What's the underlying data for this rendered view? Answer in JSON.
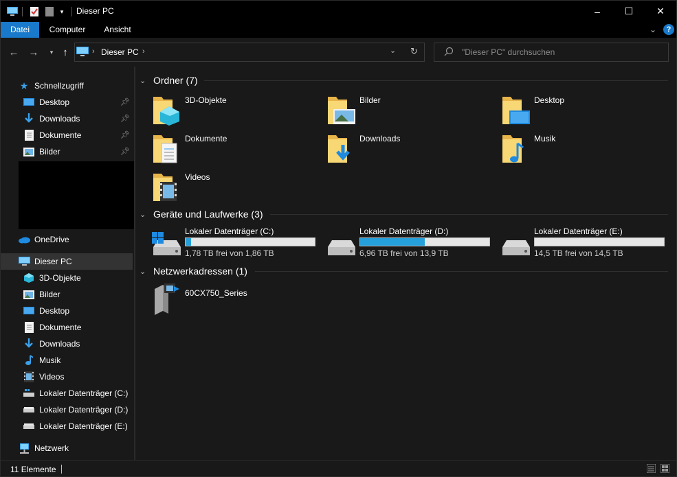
{
  "window": {
    "title": "Dieser PC",
    "controls": {
      "minimize": "–",
      "maximize": "☐",
      "close": "✕"
    }
  },
  "ribbon": {
    "tabs": [
      "Datei",
      "Computer",
      "Ansicht"
    ],
    "active_tab": "Datei",
    "accent_color": "#1979ca"
  },
  "navigation": {
    "breadcrumb": "Dieser PC",
    "search_placeholder": "\"Dieser PC\" durchsuchen"
  },
  "sidebar": {
    "quick_access": {
      "label": "Schnellzugriff",
      "items": [
        "Desktop",
        "Downloads",
        "Dokumente",
        "Bilder"
      ]
    },
    "onedrive": "OneDrive",
    "this_pc": {
      "label": "Dieser PC",
      "items": [
        "3D-Objekte",
        "Bilder",
        "Desktop",
        "Dokumente",
        "Downloads",
        "Musik",
        "Videos",
        "Lokaler Datenträger (C:)",
        "Lokaler Datenträger (D:)",
        "Lokaler Datenträger (E:)"
      ]
    },
    "network": "Netzwerk"
  },
  "content": {
    "folders_header": "Ordner (7)",
    "folders": [
      "3D-Objekte",
      "Bilder",
      "Desktop",
      "Dokumente",
      "Downloads",
      "Musik",
      "Videos"
    ],
    "drives_header": "Geräte und Laufwerke (3)",
    "drives": [
      {
        "name": "Lokaler Datenträger (C:)",
        "free": "1,78 TB frei von 1,86 TB",
        "used_fraction": 0.043
      },
      {
        "name": "Lokaler Datenträger (D:)",
        "free": "6,96 TB frei von 13,9 TB",
        "used_fraction": 0.5
      },
      {
        "name": "Lokaler Datenträger (E:)",
        "free": "14,5 TB frei von 14,5 TB",
        "used_fraction": 0.0
      }
    ],
    "network_header": "Netzwerkadressen (1)",
    "network_locations": [
      "60CX750_Series"
    ]
  },
  "statusbar": {
    "text": "11 Elemente"
  }
}
